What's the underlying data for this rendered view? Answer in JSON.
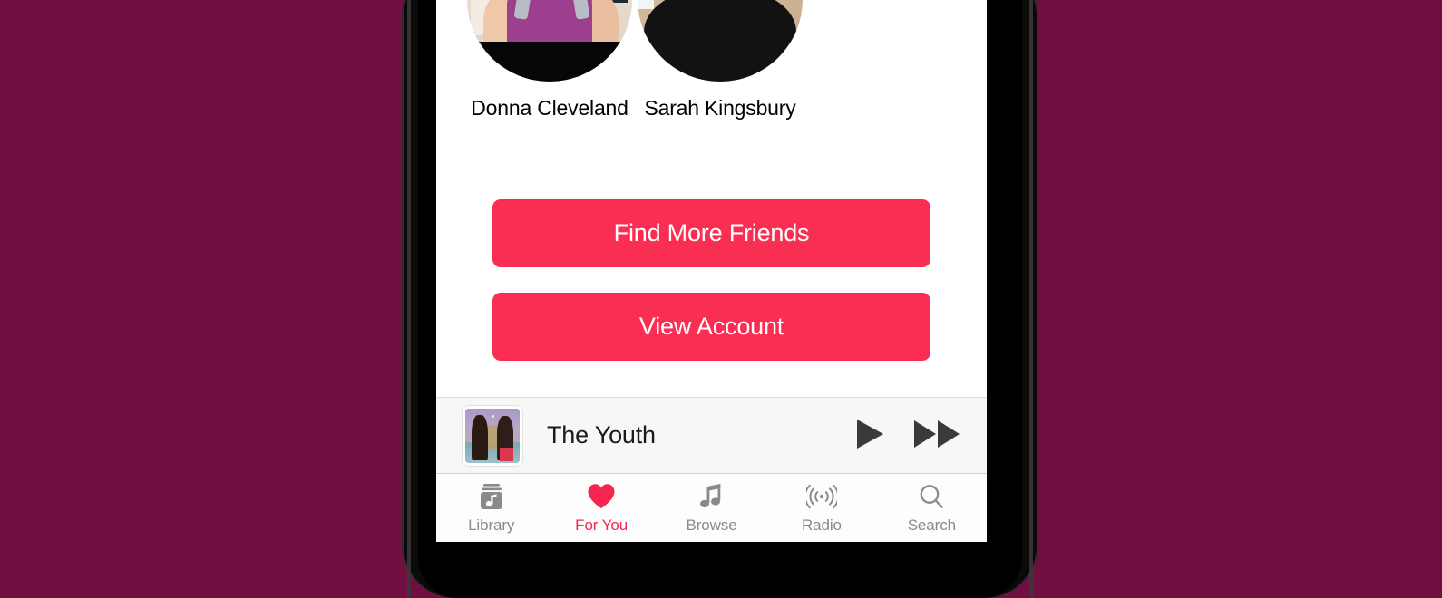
{
  "theme": {
    "backdrop_color": "#711040",
    "accent_color": "#fa2d52",
    "active_tab_color": "#f5254f",
    "screen_background": "#ffffff",
    "now_playing_background": "#f7f7f7",
    "inactive_tab_color": "#8a8a8a"
  },
  "friends": [
    {
      "name": "Donna Cleveland",
      "avatar_icon": "avatar-photo-donna"
    },
    {
      "name": "Sarah Kingsbury",
      "avatar_icon": "avatar-photo-sarah"
    }
  ],
  "actions": {
    "find_more_friends_label": "Find More Friends",
    "view_account_label": "View Account"
  },
  "now_playing": {
    "track_title": "The Youth",
    "album_art_icon": "album-artwork",
    "play_icon": "play-icon",
    "forward_icon": "fast-forward-icon"
  },
  "tab_bar": {
    "active_index": 1,
    "tabs": [
      {
        "label": "Library",
        "icon": "library-icon"
      },
      {
        "label": "For You",
        "icon": "heart-icon"
      },
      {
        "label": "Browse",
        "icon": "music-note-icon"
      },
      {
        "label": "Radio",
        "icon": "radio-waves-icon"
      },
      {
        "label": "Search",
        "icon": "search-icon"
      }
    ]
  }
}
